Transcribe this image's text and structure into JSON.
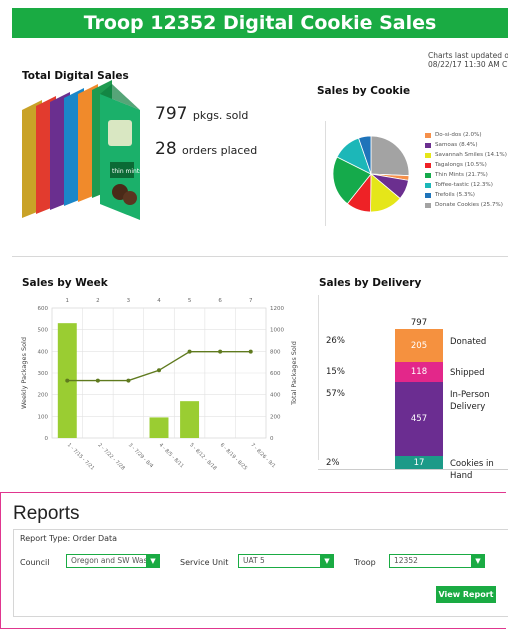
{
  "header": {
    "title": "Troop 12352 Digital Cookie Sales"
  },
  "total": {
    "heading": "Total Digital Sales",
    "pkgs_value": "797",
    "pkgs_label": "pkgs. sold",
    "orders_value": "28",
    "orders_label": "orders placed"
  },
  "updated": {
    "line1": "Charts last updated on",
    "line2": "08/22/17 11:30 AM CDT"
  },
  "by_cookie": {
    "heading": "Sales by Cookie",
    "legend": [
      {
        "label": "Do-si-dos (2.0%)",
        "color": "#f5904a"
      },
      {
        "label": "Samoas (8.4%)",
        "color": "#6b2f8f"
      },
      {
        "label": "Savannah Smiles (14.1%)",
        "color": "#e5e619"
      },
      {
        "label": "Tagalongs (10.5%)",
        "color": "#ee2226"
      },
      {
        "label": "Thin Mints (21.7%)",
        "color": "#15aa4b"
      },
      {
        "label": "Toffee-tastic (12.3%)",
        "color": "#1cb7b8"
      },
      {
        "label": "Trefoils (5.3%)",
        "color": "#1f74ba"
      },
      {
        "label": "Donate Cookies (25.7%)",
        "color": "#a3a3a3"
      }
    ]
  },
  "by_week_heading": "Sales by Week",
  "by_delivery": {
    "heading": "Sales by Delivery",
    "total": "797",
    "segments": [
      {
        "pct": "26%",
        "value": "205",
        "label": "Donated",
        "color": "#f5913f"
      },
      {
        "pct": "15%",
        "value": "118",
        "label": "Shipped",
        "color": "#e3278a"
      },
      {
        "pct": "57%",
        "value": "457",
        "label": "In-Person Delivery",
        "color": "#6b2d91"
      },
      {
        "pct": "2%",
        "value": "17",
        "label": "Cookies in Hand",
        "color": "#1c9a88"
      }
    ]
  },
  "chart_data": [
    {
      "type": "pie",
      "title": "Sales by Cookie",
      "categories": [
        "Do-si-dos",
        "Samoas",
        "Savannah Smiles",
        "Tagalongs",
        "Thin Mints",
        "Toffee-tastic",
        "Trefoils",
        "Donate Cookies"
      ],
      "values": [
        2.0,
        8.4,
        14.1,
        10.5,
        21.7,
        12.3,
        5.3,
        25.7
      ],
      "colors": [
        "#f5904a",
        "#6b2f8f",
        "#e5e619",
        "#ee2226",
        "#15aa4b",
        "#1cb7b8",
        "#1f74ba",
        "#a3a3a3"
      ]
    },
    {
      "type": "bar",
      "title": "Sales by Week",
      "categories": [
        "1 - 7/15 - 7/21",
        "2 - 7/22 - 7/28",
        "3 - 7/29 - 8/4",
        "4 - 8/5 - 8/11",
        "5 - 8/12 - 8/18",
        "6 - 8/19 - 8/25",
        "7 - 8/26 - 9/1"
      ],
      "top_ticks": [
        "1",
        "2",
        "3",
        "4",
        "5",
        "6",
        "7"
      ],
      "ylabel": "Weekly Packages Sold",
      "y2label": "Total Packages Sold",
      "ylim": [
        0,
        600
      ],
      "y2lim": [
        0,
        1200
      ],
      "yticks": [
        0,
        100,
        200,
        300,
        400,
        500,
        600
      ],
      "y2ticks": [
        0,
        200,
        400,
        600,
        800,
        1000,
        1200
      ],
      "series": [
        {
          "name": "Weekly",
          "type": "bar",
          "values": [
            530,
            0,
            0,
            95,
            170,
            0,
            0
          ],
          "color": "#9acd32"
        },
        {
          "name": "Total",
          "type": "line",
          "axis": "right",
          "values": [
            530,
            530,
            530,
            625,
            797,
            797,
            797
          ],
          "color": "#5f7a1e"
        }
      ],
      "grid": true
    },
    {
      "type": "bar",
      "title": "Sales by Delivery",
      "categories": [
        "Donated",
        "Shipped",
        "In-Person Delivery",
        "Cookies in Hand"
      ],
      "values": [
        205,
        118,
        457,
        17
      ],
      "stacked": true
    }
  ],
  "reports": {
    "title": "Reports",
    "report_type": "Report Type: Order Data",
    "council_label": "Council",
    "council_value": "Oregon and SW Was",
    "unit_label": "Service Unit",
    "unit_value": "UAT 5",
    "troop_label": "Troop",
    "troop_value": "12352",
    "button": "View Report"
  }
}
